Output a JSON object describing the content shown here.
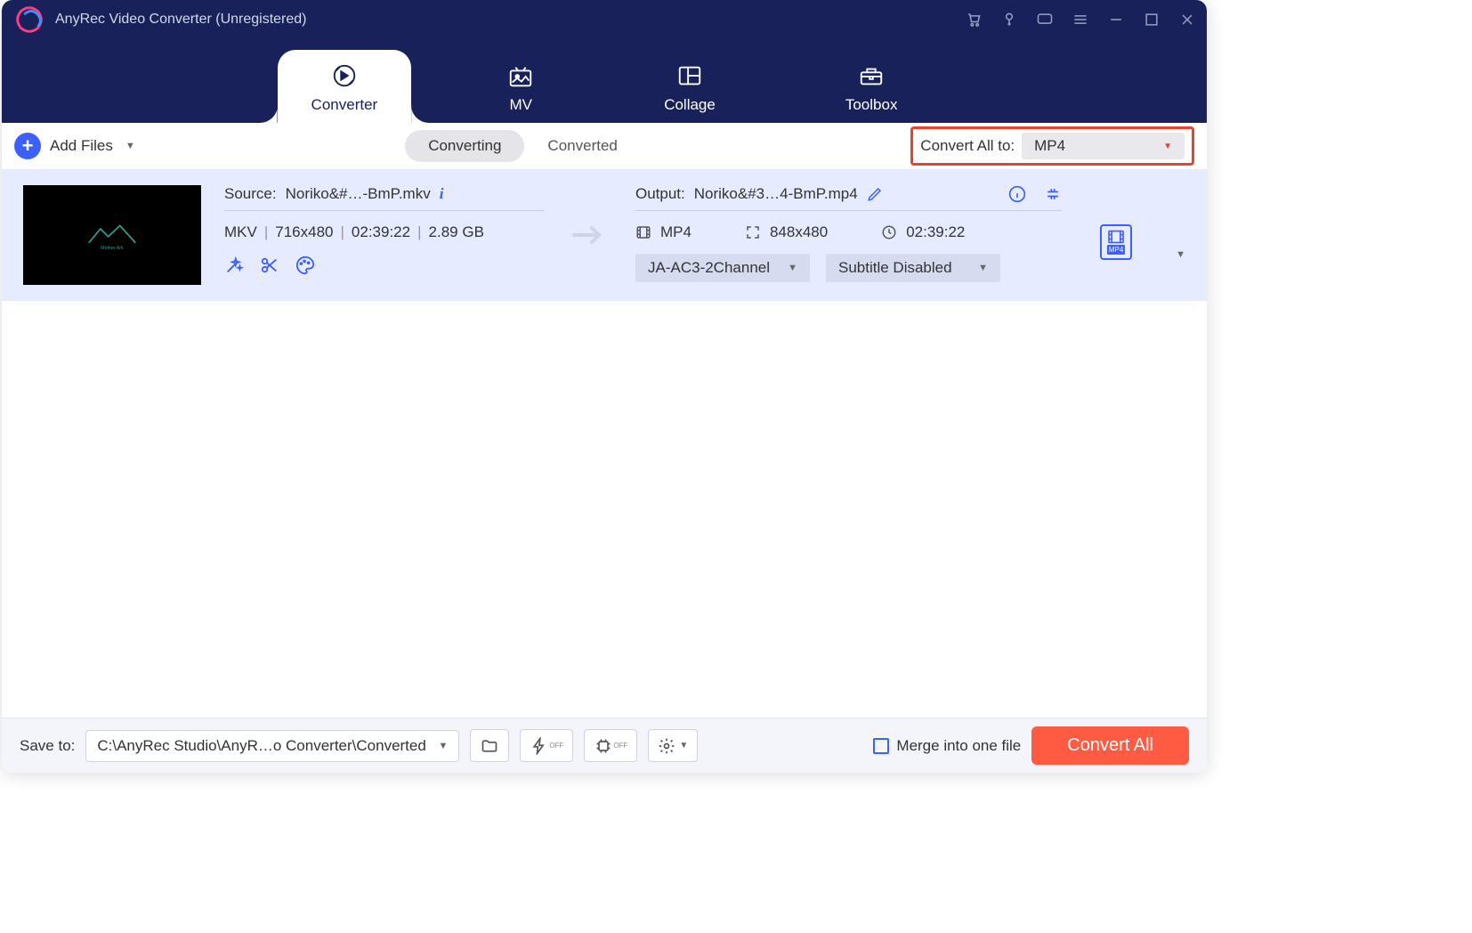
{
  "window": {
    "title": "AnyRec Video Converter (Unregistered)"
  },
  "nav": {
    "tabs": [
      {
        "label": "Converter",
        "icon": "convert-icon",
        "active": true
      },
      {
        "label": "MV",
        "icon": "mv-icon"
      },
      {
        "label": "Collage",
        "icon": "collage-icon"
      },
      {
        "label": "Toolbox",
        "icon": "toolbox-icon"
      }
    ]
  },
  "toolbar": {
    "add_files_label": "Add Files",
    "filters": {
      "converting": "Converting",
      "converted": "Converted",
      "active": "converting"
    },
    "convert_all_label": "Convert All to:",
    "convert_all_format": "MP4"
  },
  "file": {
    "source_label": "Source:",
    "source_name": "Noriko&#…-BmP.mkv",
    "source_format": "MKV",
    "source_resolution": "716x480",
    "source_duration": "02:39:22",
    "source_size": "2.89 GB",
    "output_label": "Output:",
    "output_name": "Noriko&#3…4-BmP.mp4",
    "output_format": "MP4",
    "output_resolution": "848x480",
    "output_duration": "02:39:22",
    "audio_select": "JA-AC3-2Channel",
    "subtitle_select": "Subtitle Disabled",
    "output_badge": "MP4"
  },
  "bottom": {
    "save_to_label": "Save to:",
    "save_path": "C:\\AnyRec Studio\\AnyR…o Converter\\Converted",
    "merge_label": "Merge into one file",
    "convert_btn": "Convert All"
  }
}
